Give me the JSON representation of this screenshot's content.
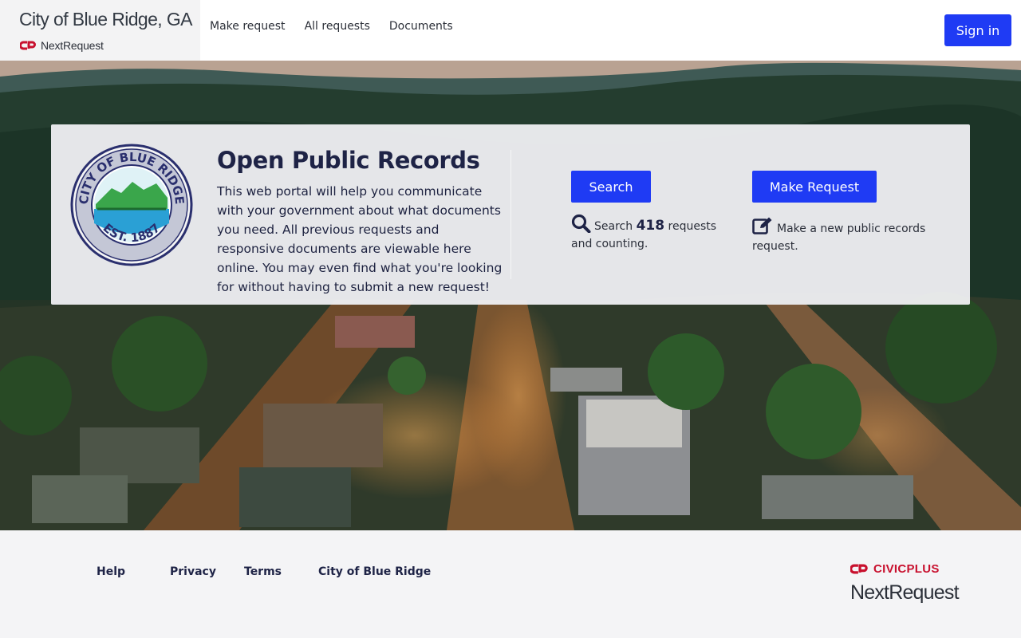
{
  "header": {
    "city_title": "City of Blue Ridge, GA",
    "product_name": "NextRequest",
    "nav": [
      "Make request",
      "All requests",
      "Documents"
    ],
    "sign_in_label": "Sign in"
  },
  "hero": {
    "title": "Open Public Records",
    "description": "This web portal will help you communicate with your government about what documents you need. All previous requests and responsive documents are viewable here online. You may even find what you're looking for without having to submit a new request!",
    "seal": {
      "top_text": "CITY OF BLUE RIDGE",
      "bottom_text": "EST. 1887"
    },
    "search_button": "Search",
    "search_prefix": "Search",
    "request_count": "418",
    "search_suffix": "requests and counting.",
    "make_request_button": "Make Request",
    "make_request_text": "Make a new public records request."
  },
  "footer": {
    "links": [
      "Help",
      "Privacy",
      "Terms",
      "City of Blue Ridge"
    ],
    "vendor_name": "CIVICPLUS",
    "product_name": "NextRequest"
  },
  "icons": {
    "logo": "nextrequest-logo-icon",
    "search": "magnifier-icon",
    "make_request": "edit-pencil-icon"
  },
  "colors": {
    "primary": "#1f3bf4",
    "brand_red": "#c8102e",
    "title_navy": "#1e2346"
  }
}
